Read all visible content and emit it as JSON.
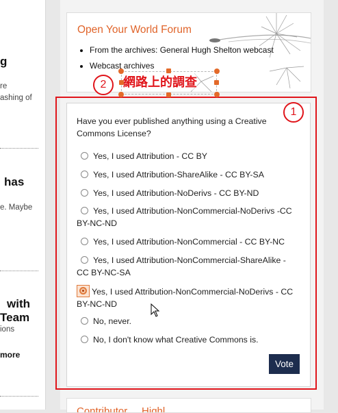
{
  "left_column": {
    "heading_1": "g",
    "text_1a": "re",
    "text_1b": "ashing of",
    "heading_2": "has",
    "text_2": "e. Maybe",
    "heading_3a": "with",
    "heading_3b": "Team",
    "text_3": "ions",
    "more_link": "more"
  },
  "forum": {
    "title": "Open Your World Forum",
    "items": [
      "From the archives: General Hugh Shelton webcast",
      "Webcast archives"
    ]
  },
  "poll": {
    "question": "Have you ever published anything using a Creative Commons License?",
    "options": [
      "Yes, I used Attribution - CC BY",
      "Yes, I used Attribution-ShareAlike - CC BY-SA",
      "Yes, I used Attribution-NoDerivs - CC BY-ND",
      "Yes, I used Attribution-NonCommercial-NoDerivs -CC BY-NC-ND",
      "Yes, I used Attribution-NonCommercial - CC BY-NC",
      "Yes, I used Attribution-NonCommercial-ShareAlike - CC BY-NC-SA",
      "Yes, I used Attribution-NonCommercial-NoDerivs - CC BY-NC-ND",
      "No, never.",
      "No, I don't know what Creative Commons is."
    ],
    "selected_index": 6,
    "vote_label": "Vote"
  },
  "annotations": {
    "badge_1": "1",
    "badge_2": "2",
    "label_2": "網路上的調查",
    "color": "#e0141a"
  },
  "bottom_block": {
    "title_fragment": "Contributor ... Highl..."
  }
}
